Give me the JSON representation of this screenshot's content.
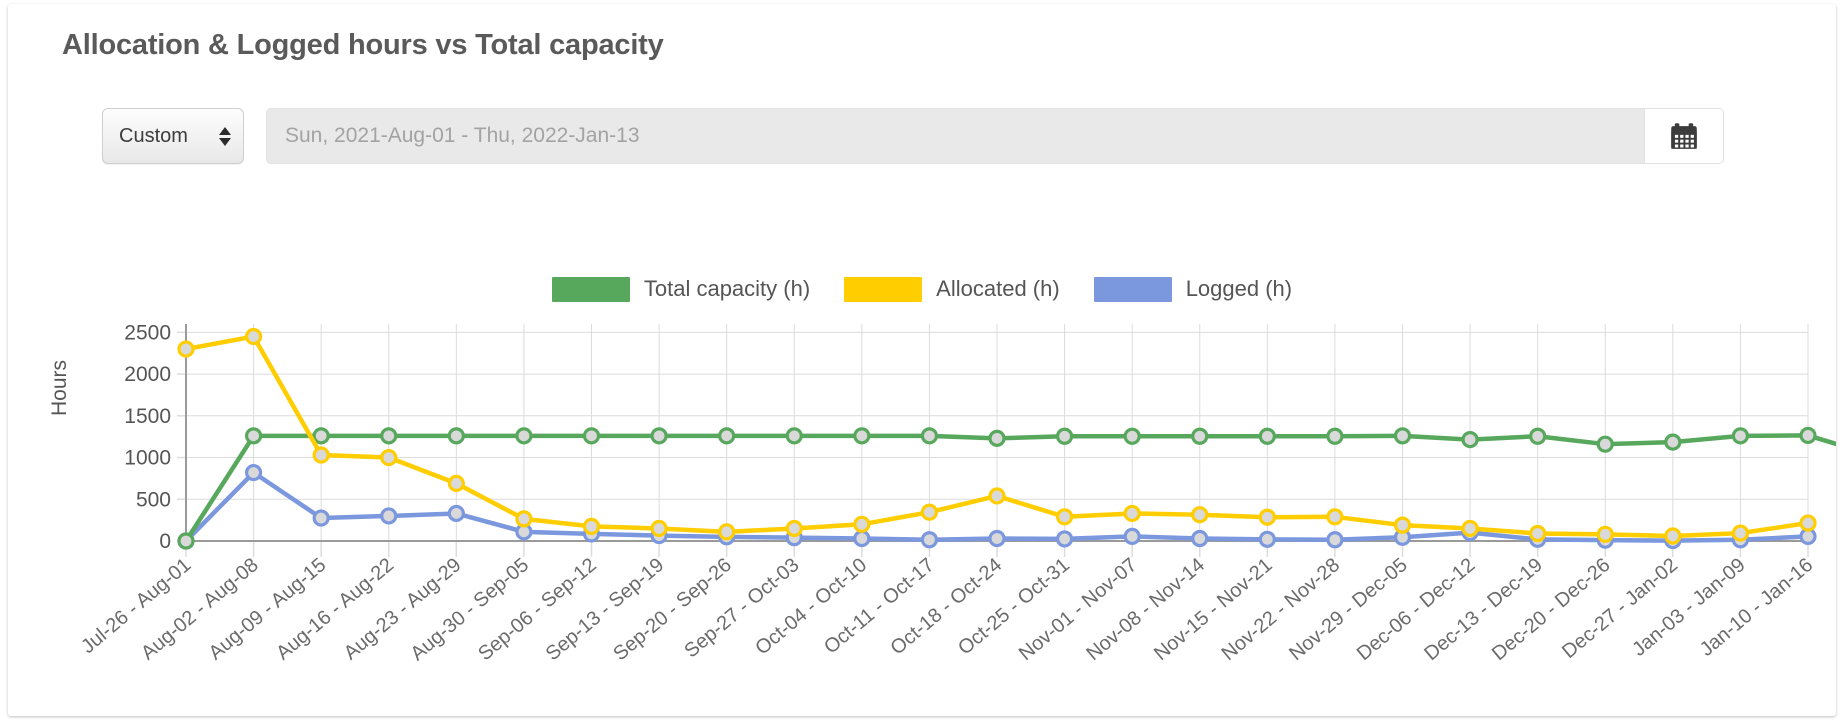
{
  "panel": {
    "title": "Allocation & Logged hours vs Total capacity"
  },
  "toolbar": {
    "range_preset": "Custom",
    "range_options": [
      "Custom"
    ],
    "date_range_value": "Sun, 2021-Aug-01 - Thu, 2022-Jan-13",
    "date_range_placeholder": "Sun, 2021-Aug-01 - Thu, 2022-Jan-13",
    "calendar_button_label": "",
    "spinner_icon": "spinner-up-down-icon",
    "calendar_icon": "calendar-icon"
  },
  "colors": {
    "total_capacity": "#57a75c",
    "allocated": "#ffcd00",
    "logged": "#7b97de",
    "grid": "#dcdcdc",
    "axis": "#9a9a9a",
    "text": "#555555",
    "title": "#5a5a5a",
    "marker_fill": "#d9d9d9"
  },
  "chart_data": {
    "type": "line",
    "title": "Allocation & Logged hours vs Total capacity",
    "xlabel": "",
    "ylabel": "Hours",
    "ylim": [
      0,
      2600
    ],
    "yticks": [
      0,
      500,
      1000,
      1500,
      2000,
      2500
    ],
    "ytick_labels": [
      "0",
      "500",
      "1000",
      "1500",
      "2000",
      "2500"
    ],
    "grid": true,
    "legend_position": "top-center",
    "categories": [
      "Jul-26 - Aug-01",
      "Aug-02 - Aug-08",
      "Aug-09 - Aug-15",
      "Aug-16 - Aug-22",
      "Aug-23 - Aug-29",
      "Aug-30 - Sep-05",
      "Sep-06 - Sep-12",
      "Sep-13 - Sep-19",
      "Sep-20 - Sep-26",
      "Sep-27 - Oct-03",
      "Oct-04 - Oct-10",
      "Oct-11 - Oct-17",
      "Oct-18 - Oct-24",
      "Oct-25 - Oct-31",
      "Nov-01 - Nov-07",
      "Nov-08 - Nov-14",
      "Nov-15 - Nov-21",
      "Nov-22 - Nov-28",
      "Nov-29 - Dec-05",
      "Dec-06 - Dec-12",
      "Dec-13 - Dec-19",
      "Dec-20 - Dec-26",
      "Dec-27 - Jan-02",
      "Jan-03 - Jan-09",
      "Jan-10 - Jan-16"
    ],
    "series": [
      {
        "name": "Total capacity (h)",
        "color": "#57a75c",
        "values": [
          0,
          1260,
          1260,
          1260,
          1260,
          1260,
          1260,
          1260,
          1260,
          1260,
          1260,
          1260,
          1230,
          1255,
          1255,
          1255,
          1255,
          1255,
          1260,
          1215,
          1255,
          1160,
          1185,
          1260,
          1265,
          1020
        ]
      },
      {
        "name": "Allocated (h)",
        "color": "#ffcd00",
        "values": [
          2300,
          2450,
          1030,
          1000,
          690,
          265,
          175,
          150,
          110,
          150,
          200,
          345,
          540,
          290,
          330,
          315,
          285,
          290,
          190,
          150,
          90,
          80,
          60,
          95,
          215
        ]
      },
      {
        "name": "Logged (h)",
        "color": "#7b97de",
        "values": [
          0,
          820,
          275,
          300,
          330,
          110,
          85,
          65,
          50,
          40,
          30,
          15,
          30,
          25,
          55,
          30,
          20,
          15,
          45,
          100,
          20,
          10,
          5,
          15,
          55
        ]
      }
    ]
  },
  "axis": {
    "y_title": "Hours"
  }
}
